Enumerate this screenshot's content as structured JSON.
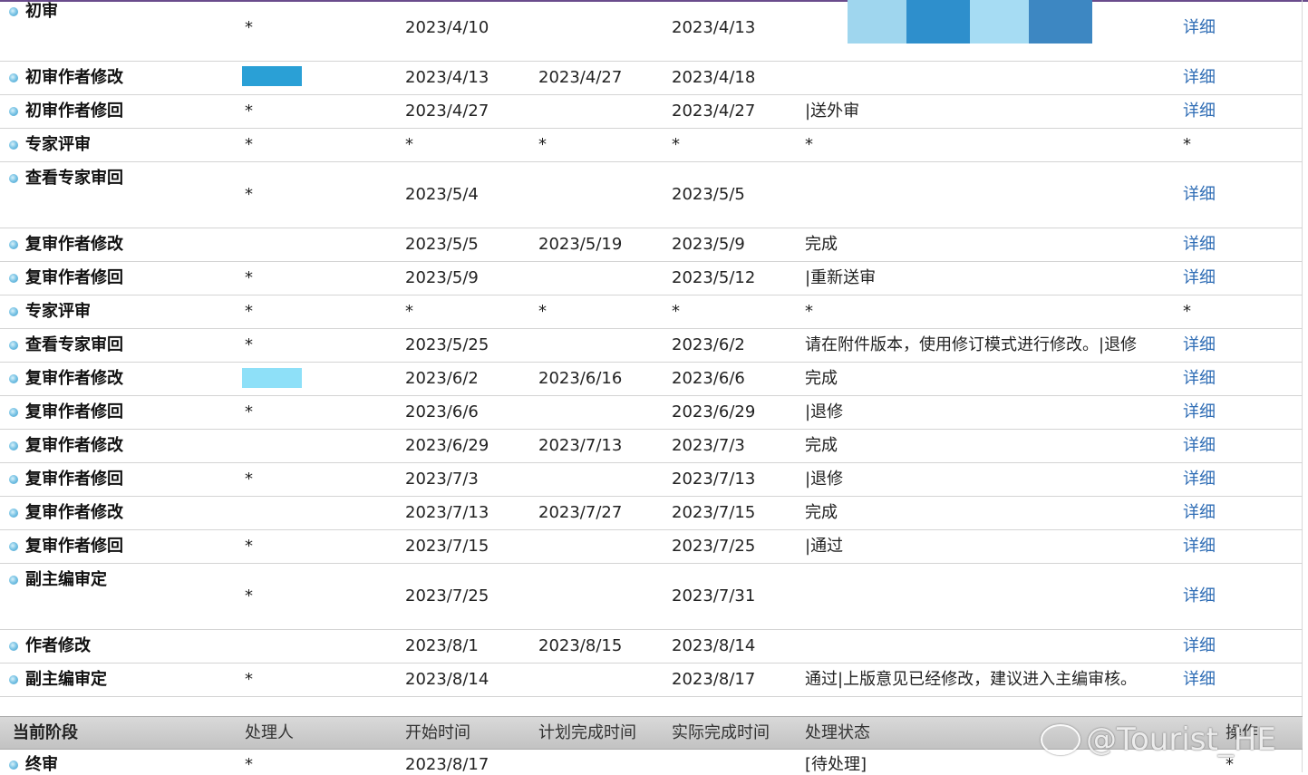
{
  "table": {
    "rows": [
      {
        "stage": "初审",
        "handler": "*",
        "start": "2023/4/10",
        "plan": "",
        "actual": "2023/4/13",
        "status": "",
        "op": "详细",
        "op_link": true
      },
      {
        "stage": "初审作者修改",
        "handler": "",
        "start": "2023/4/13",
        "plan": "2023/4/27",
        "actual": "2023/4/18",
        "status": "",
        "op": "详细",
        "op_link": true
      },
      {
        "stage": "初审作者修回",
        "handler": "*",
        "start": "2023/4/27",
        "plan": "",
        "actual": "2023/4/27",
        "status": "|送外审",
        "op": "详细",
        "op_link": true
      },
      {
        "stage": "专家评审",
        "handler": "*",
        "start": "*",
        "plan": "*",
        "actual": "*",
        "status": "*",
        "op": "*",
        "op_link": false
      },
      {
        "stage": "查看专家审回",
        "handler": "*",
        "start": "2023/5/4",
        "plan": "",
        "actual": "2023/5/5",
        "status": "",
        "op": "详细",
        "op_link": true
      },
      {
        "stage": "复审作者修改",
        "handler": "",
        "start": "2023/5/5",
        "plan": "2023/5/19",
        "actual": "2023/5/9",
        "status": "完成",
        "op": "详细",
        "op_link": true
      },
      {
        "stage": "复审作者修回",
        "handler": "*",
        "start": "2023/5/9",
        "plan": "",
        "actual": "2023/5/12",
        "status": "|重新送审",
        "op": "详细",
        "op_link": true
      },
      {
        "stage": "专家评审",
        "handler": "*",
        "start": "*",
        "plan": "*",
        "actual": "*",
        "status": "*",
        "op": "*",
        "op_link": false
      },
      {
        "stage": "查看专家审回",
        "handler": "*",
        "start": "2023/5/25",
        "plan": "",
        "actual": "2023/6/2",
        "status": "请在附件版本，使用修订模式进行修改。|退修",
        "op": "详细",
        "op_link": true
      },
      {
        "stage": "复审作者修改",
        "handler": "",
        "start": "2023/6/2",
        "plan": "2023/6/16",
        "actual": "2023/6/6",
        "status": "完成",
        "op": "详细",
        "op_link": true
      },
      {
        "stage": "复审作者修回",
        "handler": "*",
        "start": "2023/6/6",
        "plan": "",
        "actual": "2023/6/29",
        "status": "|退修",
        "op": "详细",
        "op_link": true
      },
      {
        "stage": "复审作者修改",
        "handler": "",
        "start": "2023/6/29",
        "plan": "2023/7/13",
        "actual": "2023/7/3",
        "status": "完成",
        "op": "详细",
        "op_link": true
      },
      {
        "stage": "复审作者修回",
        "handler": "*",
        "start": "2023/7/3",
        "plan": "",
        "actual": "2023/7/13",
        "status": "|退修",
        "op": "详细",
        "op_link": true
      },
      {
        "stage": "复审作者修改",
        "handler": "",
        "start": "2023/7/13",
        "plan": "2023/7/27",
        "actual": "2023/7/15",
        "status": "完成",
        "op": "详细",
        "op_link": true
      },
      {
        "stage": "复审作者修回",
        "handler": "*",
        "start": "2023/7/15",
        "plan": "",
        "actual": "2023/7/25",
        "status": "|通过",
        "op": "详细",
        "op_link": true
      },
      {
        "stage": "副主编审定",
        "handler": "*",
        "start": "2023/7/25",
        "plan": "",
        "actual": "2023/7/31",
        "status": "",
        "op": "详细",
        "op_link": true
      },
      {
        "stage": "作者修改",
        "handler": "",
        "start": "2023/8/1",
        "plan": "2023/8/15",
        "actual": "2023/8/14",
        "status": "",
        "op": "详细",
        "op_link": true
      },
      {
        "stage": "副主编审定",
        "handler": "*",
        "start": "2023/8/14",
        "plan": "",
        "actual": "2023/8/17",
        "status": "通过|上版意见已经修改，建议进入主编审核。",
        "op": "详细",
        "op_link": true
      }
    ]
  },
  "header": {
    "stage": "当前阶段",
    "handler": "处理人",
    "start": "开始时间",
    "plan": "计划完成时间",
    "actual": "实际完成时间",
    "status": "处理状态",
    "op": "操作"
  },
  "current": {
    "stage": "终审",
    "handler": "*",
    "start": "2023/8/17",
    "status": "[待处理]",
    "op": "*"
  },
  "watermark": "@Tourist_HE",
  "colors": {
    "link": "#2f6db5",
    "accent_top": "#6a4c8c",
    "header_bg": "#c8c8c8"
  }
}
